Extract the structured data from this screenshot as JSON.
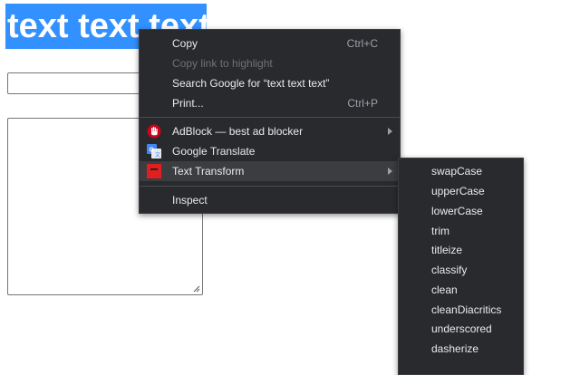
{
  "page": {
    "selected_text": "text text text"
  },
  "context_menu": {
    "copy": {
      "label": "Copy",
      "shortcut": "Ctrl+C"
    },
    "copy_link": {
      "label": "Copy link to highlight"
    },
    "search": {
      "label": "Search Google for “text text text”"
    },
    "print": {
      "label": "Print...",
      "shortcut": "Ctrl+P"
    },
    "adblock": {
      "label": "AdBlock — best ad blocker",
      "icon": "adblock-hand-icon"
    },
    "google_translate": {
      "label": "Google Translate",
      "icon": "google-translate-icon"
    },
    "text_transform": {
      "label": "Text Transform",
      "icon": "text-transform-icon"
    },
    "inspect": {
      "label": "Inspect"
    }
  },
  "submenu": {
    "items": [
      "swapCase",
      "upperCase",
      "lowerCase",
      "trim",
      "titleize",
      "classify",
      "clean",
      "cleanDiacritics",
      "underscored",
      "dasherize"
    ]
  },
  "colors": {
    "selection": "#3390ff",
    "menu_bg": "#292a2d",
    "menu_text": "#e8eaed",
    "adblock_red": "#d0021b",
    "translate_blue": "#4285f4",
    "text_transform_red": "#e02020"
  }
}
